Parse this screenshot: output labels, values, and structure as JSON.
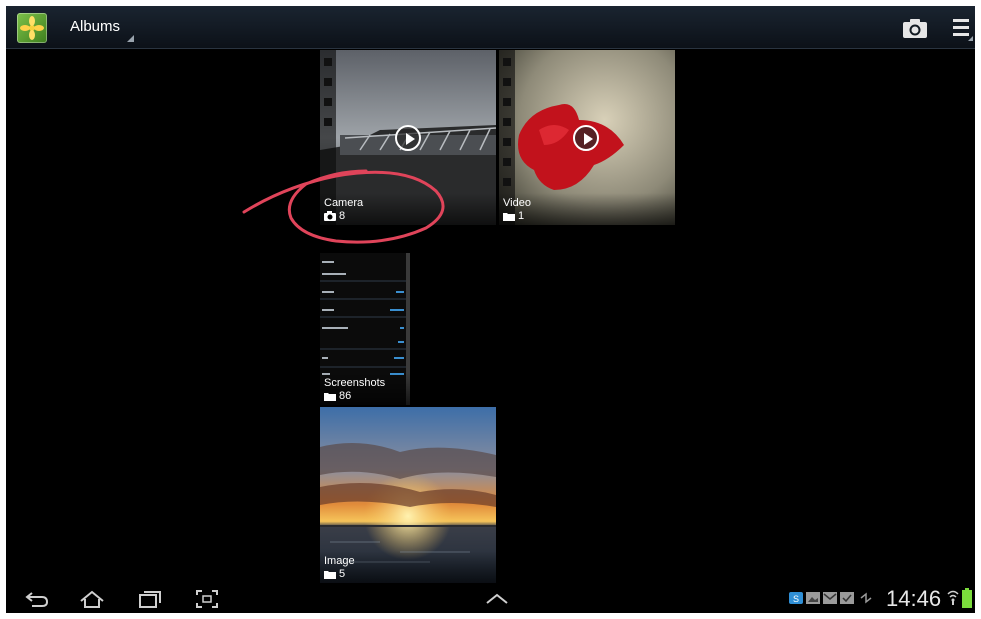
{
  "actionbar": {
    "title": "Albums",
    "app_icon": "gallery-app-icon",
    "camera_icon": "camera-icon",
    "menu_icon": "menu-icon"
  },
  "albums": [
    {
      "name": "Camera",
      "count": "8",
      "icon": "camera-icon",
      "has_play": true
    },
    {
      "name": "Video",
      "count": "1",
      "icon": "folder-icon",
      "has_play": true
    },
    {
      "name": "Screenshots",
      "count": "86",
      "icon": "folder-icon",
      "has_play": false
    },
    {
      "name": "Image",
      "count": "5",
      "icon": "folder-icon",
      "has_play": false
    }
  ],
  "system_bar": {
    "clock": "14:46",
    "nav_icons": [
      "back-icon",
      "home-icon",
      "recent-apps-icon",
      "screenshot-icon",
      "up-arrow-icon"
    ],
    "notification_icons": [
      "skype-icon",
      "gallery-notif-icon",
      "email-icon",
      "task-icon",
      "sync-icon",
      "wifi-icon",
      "battery-icon"
    ]
  },
  "colors": {
    "annotation": "#e0445a",
    "actionbar": "#121a22"
  }
}
